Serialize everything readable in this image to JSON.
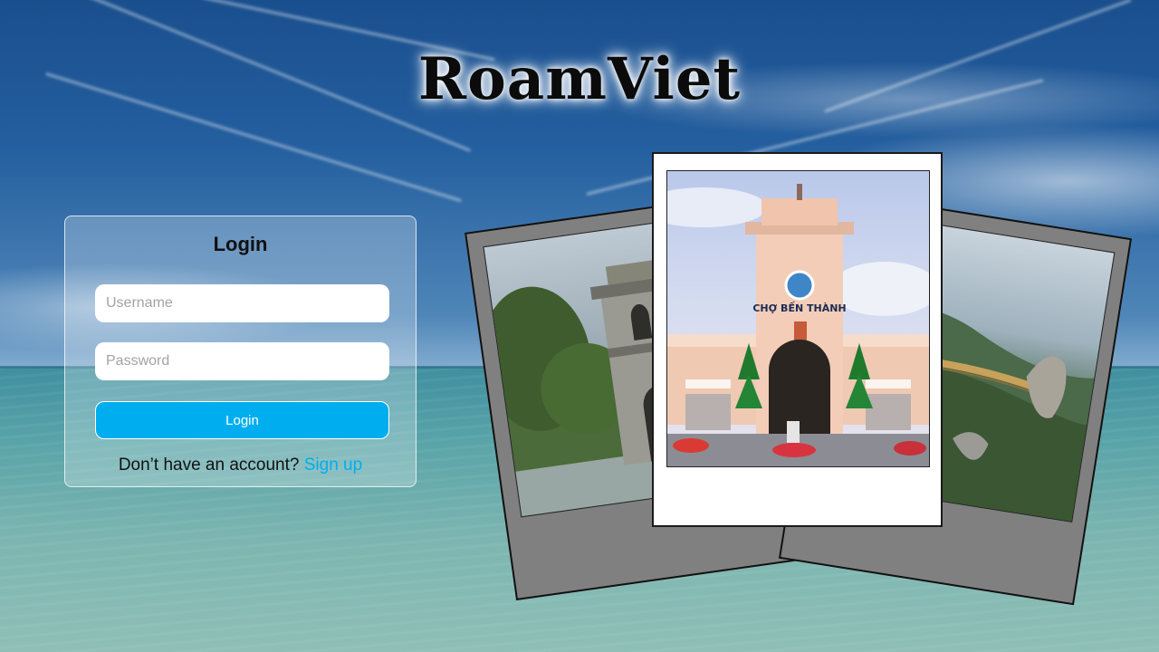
{
  "app": {
    "title": "RoamViet"
  },
  "login": {
    "heading": "Login",
    "username_placeholder": "Username",
    "password_placeholder": "Password",
    "submit_label": "Login",
    "signup_prompt": "Don’t have an account?",
    "signup_link": "Sign up"
  },
  "gallery": {
    "center_sign": "CHỢ BẾN THÀNH"
  },
  "colors": {
    "accent": "#00aeef",
    "polaroid_frame": "#808080"
  }
}
